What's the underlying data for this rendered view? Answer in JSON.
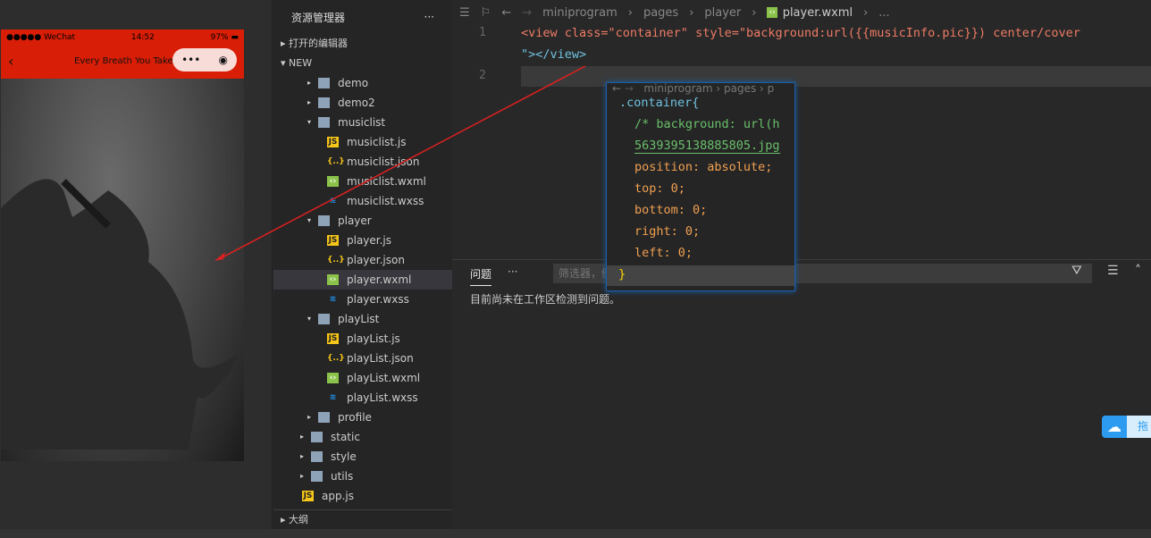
{
  "simulator": {
    "signal": "●●●●● WeChat",
    "time": "14:52",
    "battery": "97%",
    "nav_title": "Every Breath You Take",
    "back": "‹",
    "capsule_more": "•••",
    "capsule_close": "◉"
  },
  "explorer": {
    "title": "资源管理器",
    "more": "···",
    "open_editors": "打开的编辑器",
    "project": "NEW",
    "outline": "大纲",
    "items": [
      {
        "label": "demo",
        "type": "folder",
        "depth": 1,
        "open": false
      },
      {
        "label": "demo2",
        "type": "folder",
        "depth": 1,
        "open": false
      },
      {
        "label": "musiclist",
        "type": "folder",
        "depth": 1,
        "open": true
      },
      {
        "label": "musiclist.js",
        "type": "js",
        "depth": 2
      },
      {
        "label": "musiclist.json",
        "type": "json",
        "depth": 2
      },
      {
        "label": "musiclist.wxml",
        "type": "wxml",
        "depth": 2
      },
      {
        "label": "musiclist.wxss",
        "type": "wxss",
        "depth": 2
      },
      {
        "label": "player",
        "type": "folder",
        "depth": 1,
        "open": true
      },
      {
        "label": "player.js",
        "type": "js",
        "depth": 2
      },
      {
        "label": "player.json",
        "type": "json",
        "depth": 2
      },
      {
        "label": "player.wxml",
        "type": "wxml",
        "depth": 2,
        "selected": true
      },
      {
        "label": "player.wxss",
        "type": "wxss",
        "depth": 2
      },
      {
        "label": "playList",
        "type": "folder",
        "depth": 1,
        "open": true
      },
      {
        "label": "playList.js",
        "type": "js",
        "depth": 2
      },
      {
        "label": "playList.json",
        "type": "json",
        "depth": 2
      },
      {
        "label": "playList.wxml",
        "type": "wxml",
        "depth": 2
      },
      {
        "label": "playList.wxss",
        "type": "wxss",
        "depth": 2
      },
      {
        "label": "profile",
        "type": "folder",
        "depth": 1,
        "open": false
      },
      {
        "label": "static",
        "type": "folder",
        "depth": 0,
        "open": false
      },
      {
        "label": "style",
        "type": "folder",
        "depth": 0,
        "open": false
      },
      {
        "label": "utils",
        "type": "folder",
        "depth": 0,
        "open": false
      },
      {
        "label": "app.js",
        "type": "js",
        "depth": 0
      }
    ]
  },
  "editor": {
    "breadcrumb": [
      "miniprogram",
      "pages",
      "player",
      "player.wxml",
      "..."
    ],
    "lines": [
      {
        "n": "1"
      },
      {
        "n": "2"
      }
    ],
    "code1a": "<view class=\"container\" style=\"background:url({{musicInfo.pic}}) center/cover",
    "code1b": "\"></view>"
  },
  "peek": {
    "breadcrumb": "miniprogram › pages › p",
    "lines": [
      ".container{",
      "/* background: url(h",
      "5639395138885805.jpg",
      "position: absolute;",
      "top: 0;",
      "bottom: 0;",
      "right: 0;",
      "left: 0;",
      "}"
    ]
  },
  "panel": {
    "tab": "问题",
    "more": "···",
    "filter_placeholder": "筛选器，例",
    "message": "目前尚未在工作区检测到问题。"
  },
  "baidu": {
    "label": "拖"
  }
}
